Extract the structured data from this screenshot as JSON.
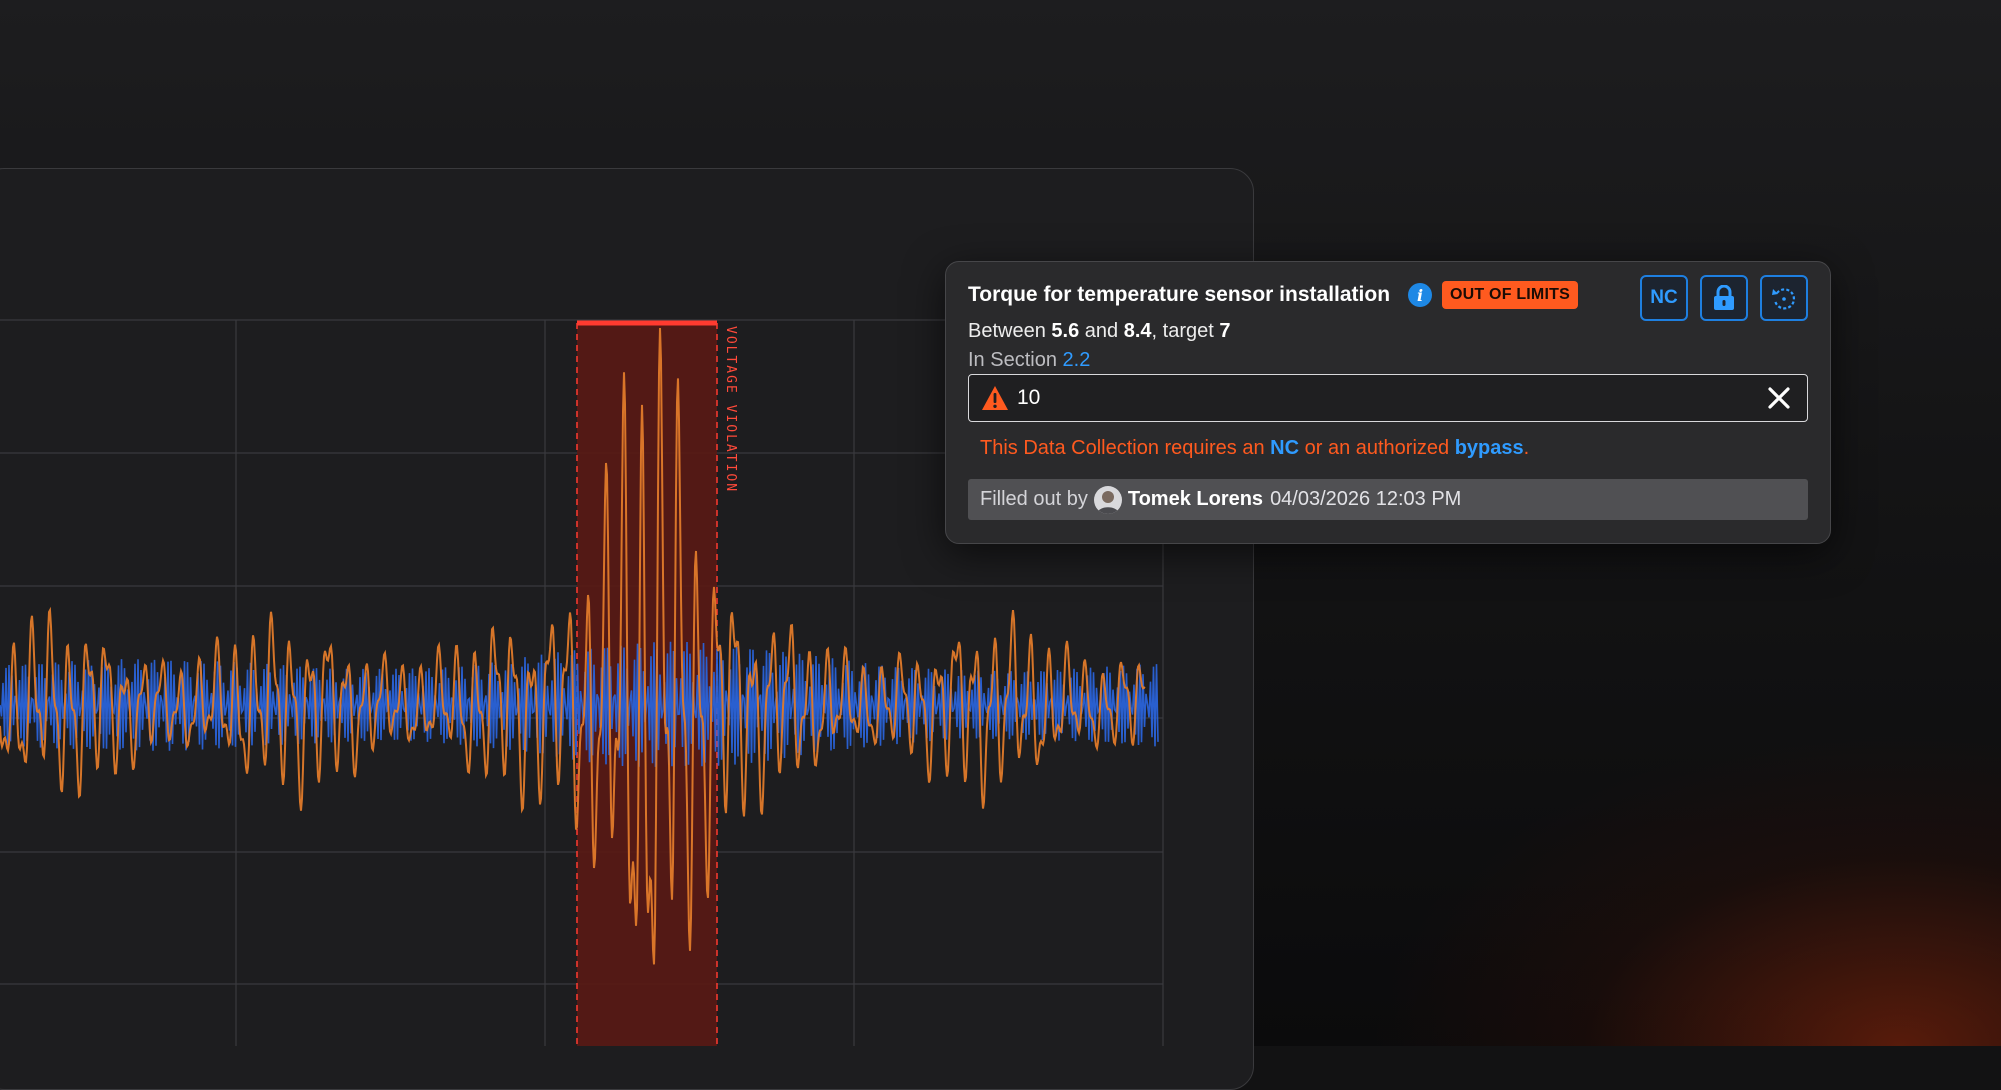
{
  "popup": {
    "title": "Torque for temperature sensor installation",
    "status_badge": "OUT OF LIMITS",
    "range": {
      "prefix": "Between",
      "min": "5.6",
      "and": "and",
      "max": "8.4",
      "target_label": ", target",
      "target": "7"
    },
    "section": {
      "prefix": "In Section",
      "value": "2.2"
    },
    "actions": {
      "nc_label": "NC"
    },
    "input": {
      "value": "10"
    },
    "message": {
      "part1": "This Data Collection requires an",
      "nc": "NC",
      "part2": "or an authorized",
      "bypass": "bypass",
      "end": "."
    },
    "filled_by": {
      "label": "Filled out by",
      "user": "Tomek Lorens",
      "timestamp": "04/03/2026 12:03 PM"
    }
  },
  "chart_data": {
    "type": "line",
    "series": [
      {
        "color": "#e07a2a"
      },
      {
        "color": "#2a63d9"
      }
    ],
    "violation_band": {
      "label": "VOLTAGE VIOLATION",
      "color": "#ff3b30"
    },
    "grid": true
  },
  "colors": {
    "accent": "#1e88e5",
    "warning": "#ff5a1f",
    "background": "#121213"
  }
}
